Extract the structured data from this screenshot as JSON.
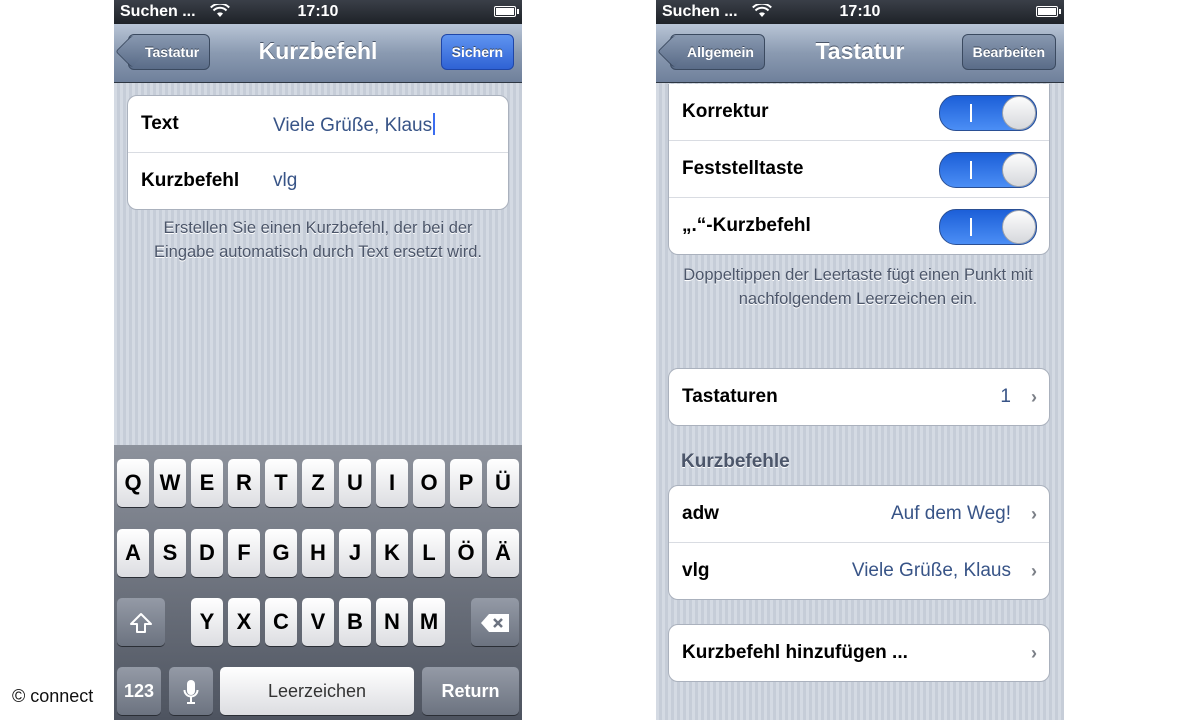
{
  "watermark": "© connect",
  "left_screen": {
    "status": {
      "carrier": "Suchen ...",
      "time": "17:10"
    },
    "nav": {
      "back_label": "Tastatur",
      "title": "Kurzbefehl",
      "save_label": "Sichern"
    },
    "form": {
      "text_label": "Text",
      "text_value": "Viele Grüße, Klaus",
      "shortcut_label": "Kurzbefehl",
      "shortcut_value": "vlg"
    },
    "hint": "Erstellen Sie einen Kurzbefehl, der bei der Eingabe automatisch durch Text ersetzt wird.",
    "keyboard": {
      "row1": [
        "Q",
        "W",
        "E",
        "R",
        "T",
        "Z",
        "U",
        "I",
        "O",
        "P",
        "Ü"
      ],
      "row2": [
        "A",
        "S",
        "D",
        "F",
        "G",
        "H",
        "J",
        "K",
        "L",
        "Ö",
        "Ä"
      ],
      "row3": [
        "Y",
        "X",
        "C",
        "V",
        "B",
        "N",
        "M"
      ],
      "numbers_label": "123",
      "space_label": "Leerzeichen",
      "return_label": "Return"
    }
  },
  "right_screen": {
    "status": {
      "carrier": "Suchen ...",
      "time": "17:10"
    },
    "nav": {
      "back_label": "Allgemein",
      "title": "Tastatur",
      "edit_label": "Bearbeiten"
    },
    "toggles": [
      {
        "label": "Korrektur",
        "on": true
      },
      {
        "label": "Feststelltaste",
        "on": true
      },
      {
        "label": "„.“-Kurzbefehl",
        "on": true
      }
    ],
    "toggle_hint": "Doppeltippen der Leertaste fügt einen Punkt mit nachfolgendem Leerzeichen ein.",
    "keyboards": {
      "label": "Tastaturen",
      "count": "1"
    },
    "shortcuts_header": "Kurzbefehle",
    "shortcuts": [
      {
        "key": "adw",
        "phrase": "Auf dem Weg!"
      },
      {
        "key": "vlg",
        "phrase": "Viele Grüße, Klaus"
      }
    ],
    "add_shortcut": "Kurzbefehl hinzufügen ..."
  }
}
